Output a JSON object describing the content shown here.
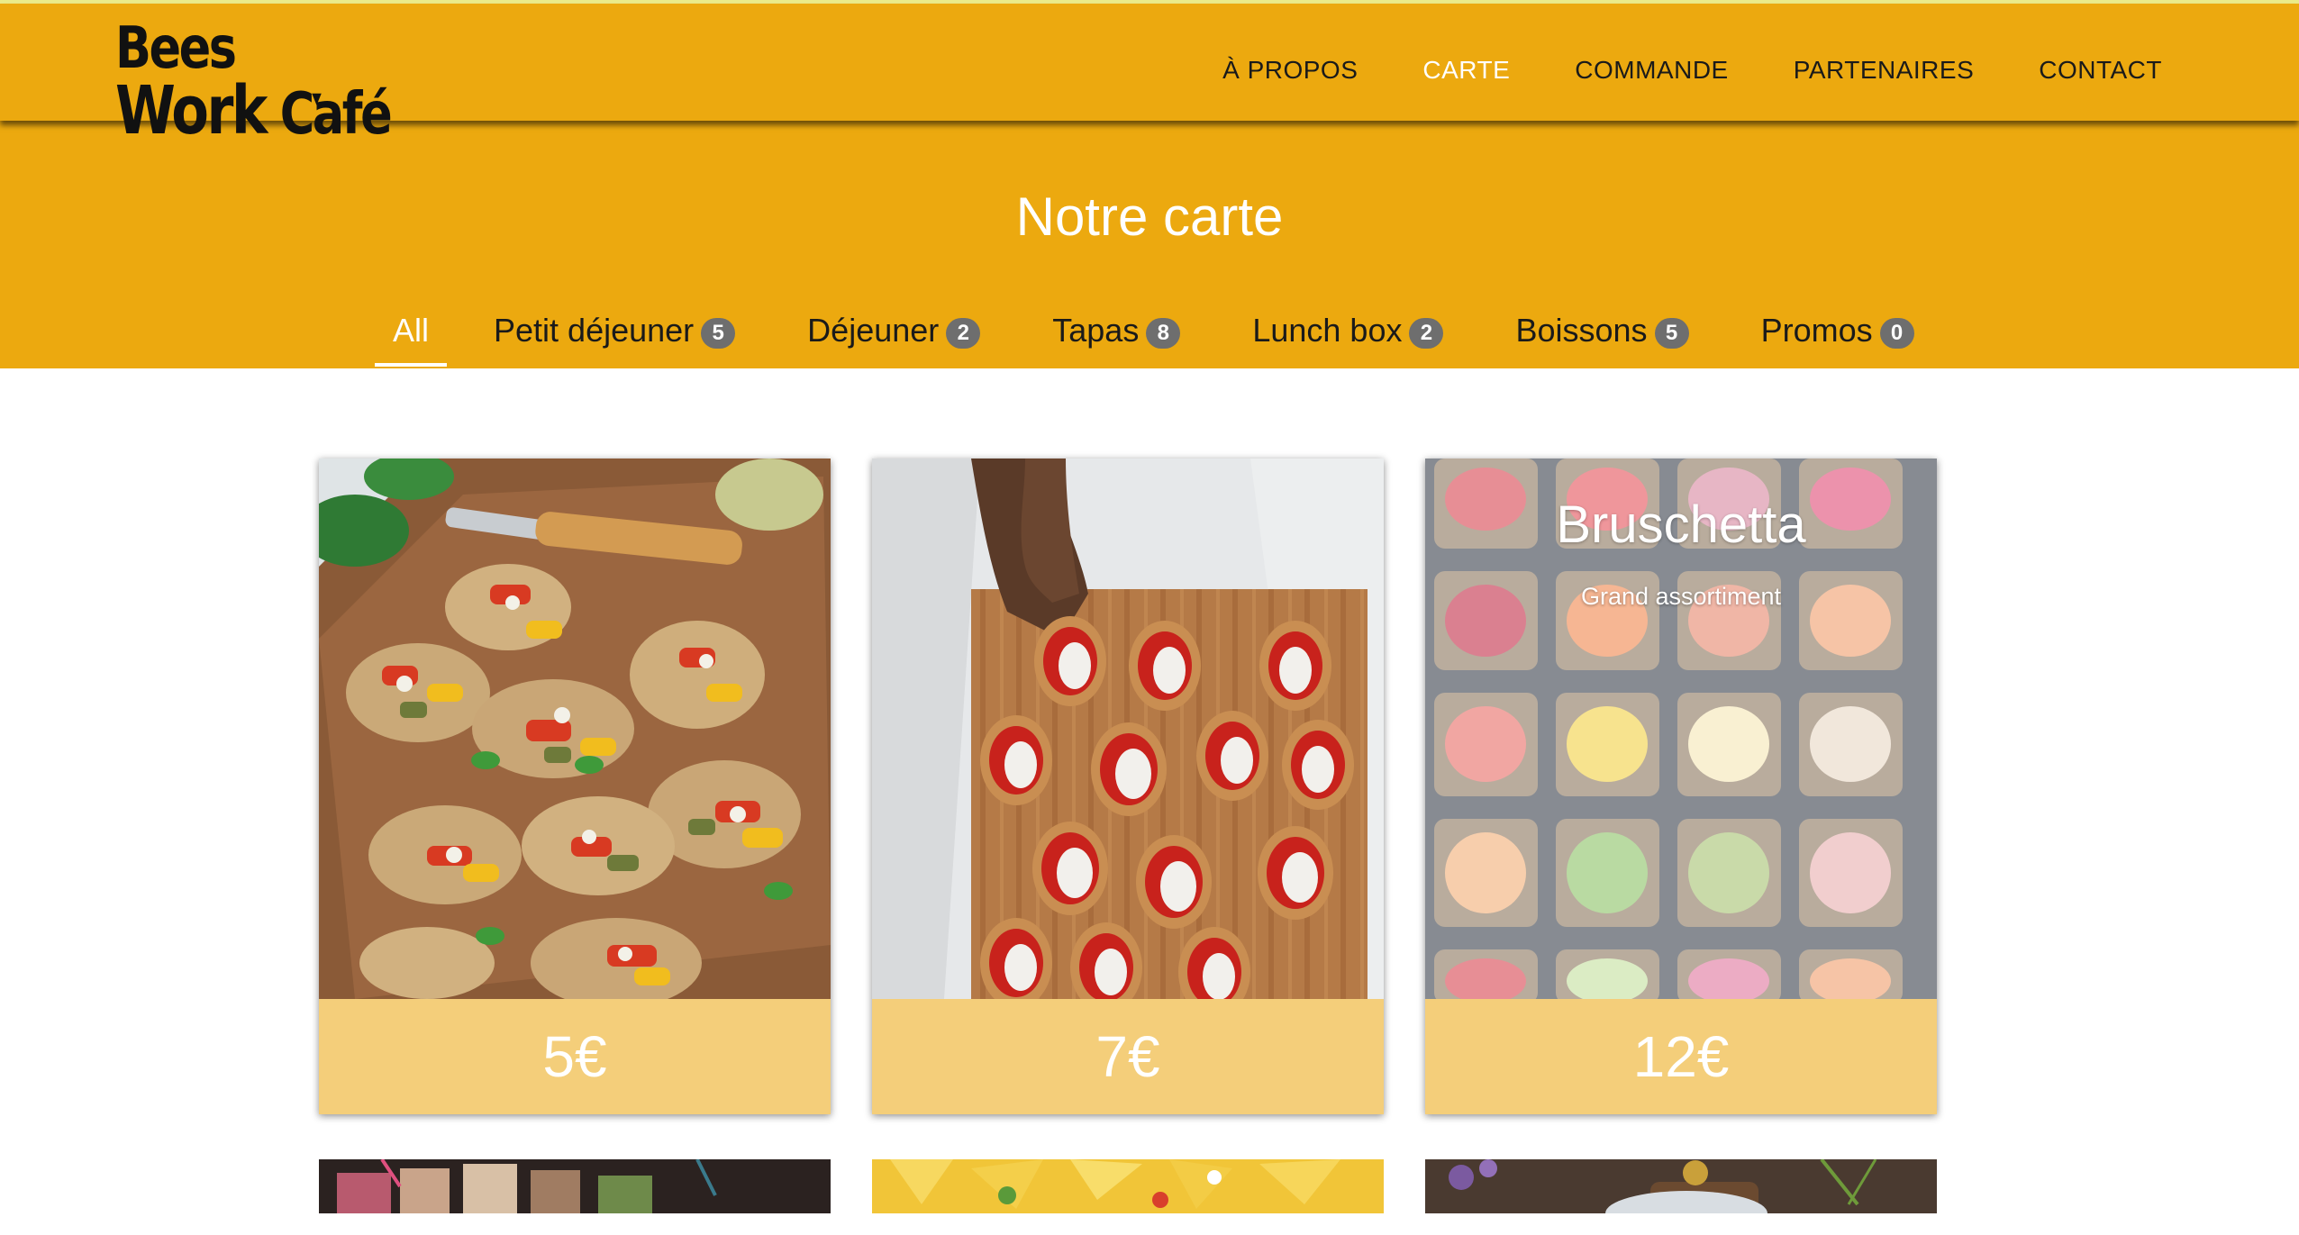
{
  "brand": {
    "logo_text_1": "Bees",
    "logo_text_2": "Work",
    "logo_text_3": "Café"
  },
  "nav": {
    "links": [
      {
        "label": "À PROPOS"
      },
      {
        "label": "CARTE",
        "active": true
      },
      {
        "label": "COMMANDE"
      },
      {
        "label": "PARTENAIRES"
      },
      {
        "label": "CONTACT"
      }
    ]
  },
  "hero": {
    "title": "Notre carte"
  },
  "filters": [
    {
      "label": "All",
      "active": true
    },
    {
      "label": "Petit déjeuner",
      "count": "5"
    },
    {
      "label": "Déjeuner",
      "count": "2"
    },
    {
      "label": "Tapas",
      "count": "8"
    },
    {
      "label": "Lunch box",
      "count": "2"
    },
    {
      "label": "Boissons",
      "count": "5"
    },
    {
      "label": "Promos",
      "count": "0"
    }
  ],
  "cards": [
    {
      "price": "5€",
      "image": "grilled-vegetable-bruschetta-image"
    },
    {
      "price": "7€",
      "image": "tomato-bruschetta-board-image"
    },
    {
      "price": "12€",
      "image": "open-sandwich-assortment-image",
      "title": "Bruschetta",
      "subtitle": "Grand assortiment"
    }
  ],
  "partial_cards": [
    {
      "image": "smoothies-drinks-image"
    },
    {
      "image": "nachos-chips-image"
    },
    {
      "image": "herbs-bread-image"
    }
  ],
  "colors": {
    "brand_yellow": "#eca90f",
    "price_bar": "#f4ce7a",
    "badge": "#6e6e6e"
  }
}
